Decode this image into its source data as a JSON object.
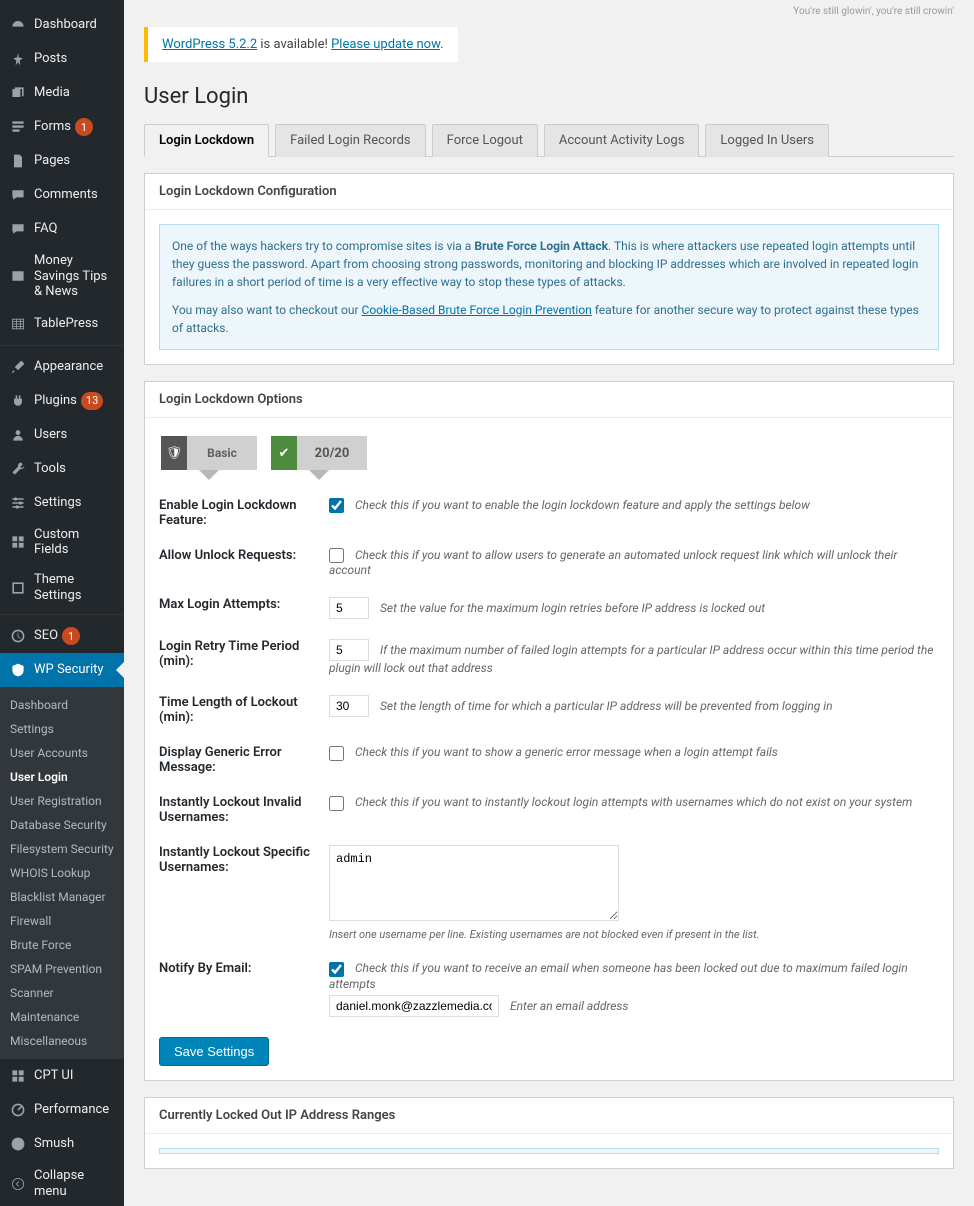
{
  "topright": "You're still glowin', you're still crowin'",
  "update_nag": {
    "link1": "WordPress 5.2.2",
    "mid": " is available! ",
    "link2": "Please update now",
    "tail": "."
  },
  "page_title": "User Login",
  "sidebar": {
    "items": [
      {
        "label": "Dashboard",
        "icon": "dashboard"
      },
      {
        "label": "Posts",
        "icon": "pin"
      },
      {
        "label": "Media",
        "icon": "media"
      },
      {
        "label": "Forms",
        "icon": "forms",
        "badge": "1"
      },
      {
        "label": "Pages",
        "icon": "pages"
      },
      {
        "label": "Comments",
        "icon": "comments"
      },
      {
        "label": "FAQ",
        "icon": "faq"
      },
      {
        "label": "Money Savings Tips & News",
        "icon": "news"
      },
      {
        "label": "TablePress",
        "icon": "table"
      }
    ],
    "items2": [
      {
        "label": "Appearance",
        "icon": "brush"
      },
      {
        "label": "Plugins",
        "icon": "plug",
        "badge": "13"
      },
      {
        "label": "Users",
        "icon": "user"
      },
      {
        "label": "Tools",
        "icon": "wrench"
      },
      {
        "label": "Settings",
        "icon": "sliders"
      },
      {
        "label": "Custom Fields",
        "icon": "grid"
      },
      {
        "label": "Theme Settings",
        "icon": "theme"
      }
    ],
    "items3": [
      {
        "label": "SEO",
        "icon": "seo",
        "badge": "1"
      },
      {
        "label": "WP Security",
        "icon": "shield",
        "active": true
      }
    ],
    "submenu": [
      "Dashboard",
      "Settings",
      "User Accounts",
      "User Login",
      "User Registration",
      "Database Security",
      "Filesystem Security",
      "WHOIS Lookup",
      "Blacklist Manager",
      "Firewall",
      "Brute Force",
      "SPAM Prevention",
      "Scanner",
      "Maintenance",
      "Miscellaneous"
    ],
    "submenu_current": "User Login",
    "items4": [
      {
        "label": "CPT UI",
        "icon": "cpt"
      },
      {
        "label": "Performance",
        "icon": "perf"
      },
      {
        "label": "Smush",
        "icon": "smush"
      },
      {
        "label": "Collapse menu",
        "icon": "collapse"
      }
    ]
  },
  "tabs": [
    "Login Lockdown",
    "Failed Login Records",
    "Force Logout",
    "Account Activity Logs",
    "Logged In Users"
  ],
  "active_tab": "Login Lockdown",
  "panel1_title": "Login Lockdown Configuration",
  "info": {
    "pre": "One of the ways hackers try to compromise sites is via a ",
    "bold": "Brute Force Login Attack",
    "rest": ". This is where attackers use repeated login attempts until they guess the password. Apart from choosing strong passwords, monitoring and blocking IP addresses which are involved in repeated login failures in a short period of time is a very effective way to stop these types of attacks.",
    "p2_pre": "You may also want to checkout our ",
    "p2_link": "Cookie-Based Brute Force Login Prevention",
    "p2_post": " feature for another secure way to protect against these types of attacks."
  },
  "panel2_title": "Login Lockdown Options",
  "ribbons": {
    "basic": "Basic",
    "score": "20/20"
  },
  "form": {
    "enable": {
      "label": "Enable Login Lockdown Feature:",
      "checked": true,
      "desc": "Check this if you want to enable the login lockdown feature and apply the settings below"
    },
    "allow_unlock": {
      "label": "Allow Unlock Requests:",
      "checked": false,
      "desc": "Check this if you want to allow users to generate an automated unlock request link which will unlock their account"
    },
    "max_attempts": {
      "label": "Max Login Attempts:",
      "value": "5",
      "desc": "Set the value for the maximum login retries before IP address is locked out"
    },
    "retry_period": {
      "label": "Login Retry Time Period (min):",
      "value": "5",
      "desc": "If the maximum number of failed login attempts for a particular IP address occur within this time period the plugin will lock out that address"
    },
    "lockout_len": {
      "label": "Time Length of Lockout (min):",
      "value": "30",
      "desc": "Set the length of time for which a particular IP address will be prevented from logging in"
    },
    "generic_err": {
      "label": "Display Generic Error Message:",
      "checked": false,
      "desc": "Check this if you want to show a generic error message when a login attempt fails"
    },
    "invalid_users": {
      "label": "Instantly Lockout Invalid Usernames:",
      "checked": false,
      "desc": "Check this if you want to instantly lockout login attempts with usernames which do not exist on your system"
    },
    "specific_users": {
      "label": "Instantly Lockout Specific Usernames:",
      "value": "admin",
      "note": "Insert one username per line. Existing usernames are not blocked even if present in the list."
    },
    "notify": {
      "label": "Notify By Email:",
      "checked": true,
      "desc": "Check this if you want to receive an email when someone has been locked out due to maximum failed login attempts",
      "email": "daniel.monk@zazzlemedia.co.uk",
      "placeholder": "Enter an email address"
    },
    "save": "Save Settings"
  },
  "panel3_title": "Currently Locked Out IP Address Ranges"
}
